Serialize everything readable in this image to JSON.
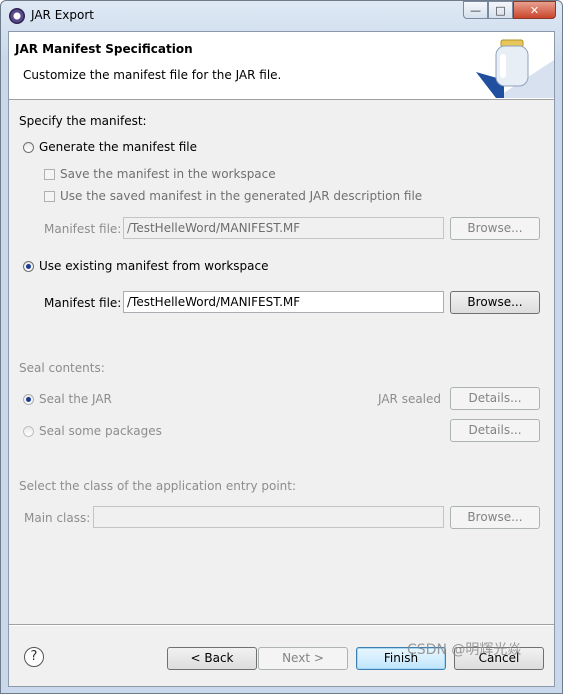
{
  "window": {
    "title": "JAR Export",
    "minimize_glyph": "—",
    "maximize_glyph": "□",
    "close_glyph": "✕"
  },
  "header": {
    "title": "JAR Manifest Specification",
    "description": "Customize the manifest file for the JAR file."
  },
  "manifest": {
    "section_label": "Specify the manifest:",
    "generate_label": "Generate the manifest file",
    "save_in_workspace_label": "Save the manifest in the workspace",
    "use_saved_label": "Use the saved manifest in the generated JAR description file",
    "generated_file_label": "Manifest file:",
    "generated_file_value": "/TestHelleWord/MANIFEST.MF",
    "generated_browse_label": "Browse...",
    "use_existing_label": "Use existing manifest from workspace",
    "existing_file_label": "Manifest file:",
    "existing_file_value": "/TestHelleWord/MANIFEST.MF",
    "existing_browse_label": "Browse..."
  },
  "seal": {
    "section_label": "Seal contents:",
    "seal_jar_label": "Seal the JAR",
    "jar_sealed_status": "JAR sealed",
    "details_label_1": "Details...",
    "seal_packages_label": "Seal some packages",
    "details_label_2": "Details..."
  },
  "entry_point": {
    "section_label": "Select the class of the application entry point:",
    "main_class_label": "Main class:",
    "main_class_value": "",
    "browse_label": "Browse..."
  },
  "footer": {
    "help_glyph": "?",
    "back_label": "< Back",
    "next_label": "Next >",
    "finish_label": "Finish",
    "cancel_label": "Cancel"
  },
  "watermark": "CSDN @明辉光焱",
  "icons": [
    "app-icon",
    "jar-icon",
    "help-icon"
  ]
}
